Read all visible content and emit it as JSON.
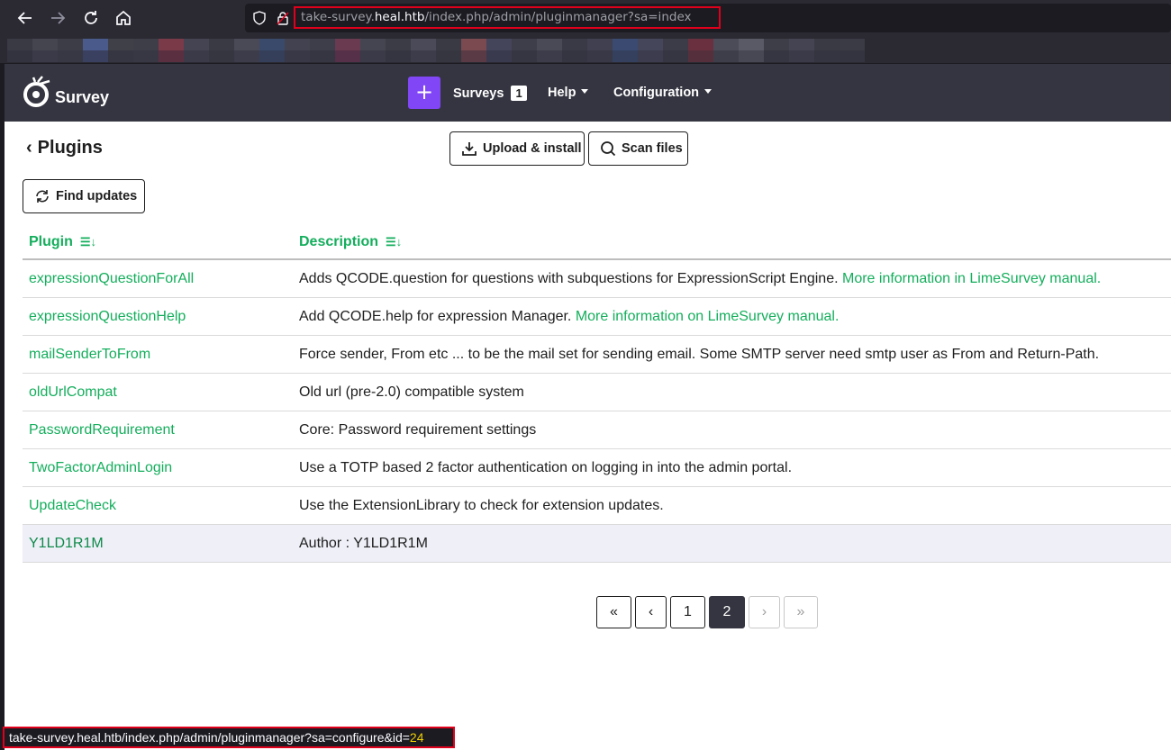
{
  "browser": {
    "url_domain_pre": "take-survey.",
    "url_domain": "heal.htb",
    "url_path": "/index.php/admin/pluginmanager?sa=index",
    "status_url_prefix": "take-survey.heal.htb/index.php/admin/pluginmanager?sa=configure&id=",
    "status_url_id": "24"
  },
  "nav": {
    "brand": "Survey",
    "add_label": "+",
    "surveys_label": "Surveys",
    "surveys_count": "1",
    "help_label": "Help",
    "config_label": "Configuration"
  },
  "toolbar": {
    "back_chevron": "‹",
    "title": "Plugins",
    "upload_label": "Upload & install",
    "scan_label": "Scan files",
    "find_updates_label": "Find updates"
  },
  "table": {
    "col_plugin": "Plugin",
    "col_description": "Description",
    "rows": [
      {
        "name": "expressionQuestionForAll",
        "desc": "Adds QCODE.question for questions with subquestions for ExpressionScript Engine. ",
        "link": "More information in LimeSurvey manual."
      },
      {
        "name": "expressionQuestionHelp",
        "desc": "Add QCODE.help for expression Manager. ",
        "link": "More information on LimeSurvey manual."
      },
      {
        "name": "mailSenderToFrom",
        "desc": "Force sender, From etc ... to be the mail set for sending email. Some SMTP server need smtp user as From and Return-Path.",
        "link": ""
      },
      {
        "name": "oldUrlCompat",
        "desc": "Old url (pre-2.0) compatible system",
        "link": ""
      },
      {
        "name": "PasswordRequirement",
        "desc": "Core: Password requirement settings",
        "link": ""
      },
      {
        "name": "TwoFactorAdminLogin",
        "desc": "Use a TOTP based 2 factor authentication on logging in into the admin portal.",
        "link": ""
      },
      {
        "name": "UpdateCheck",
        "desc": "Use the ExtensionLibrary to check for extension updates.",
        "link": ""
      },
      {
        "name": "Y1LD1R1M",
        "desc": "Author : Y1LD1R1M",
        "link": ""
      }
    ]
  },
  "pagination": {
    "first": "«",
    "prev": "‹",
    "page1": "1",
    "page2": "2",
    "next": "›",
    "last": "»",
    "current_page": 2
  },
  "colors": {
    "accent_green": "#14ae5c",
    "nav_bg": "#353541",
    "add_button": "#8146f6",
    "highlight_red": "#e0001b"
  }
}
